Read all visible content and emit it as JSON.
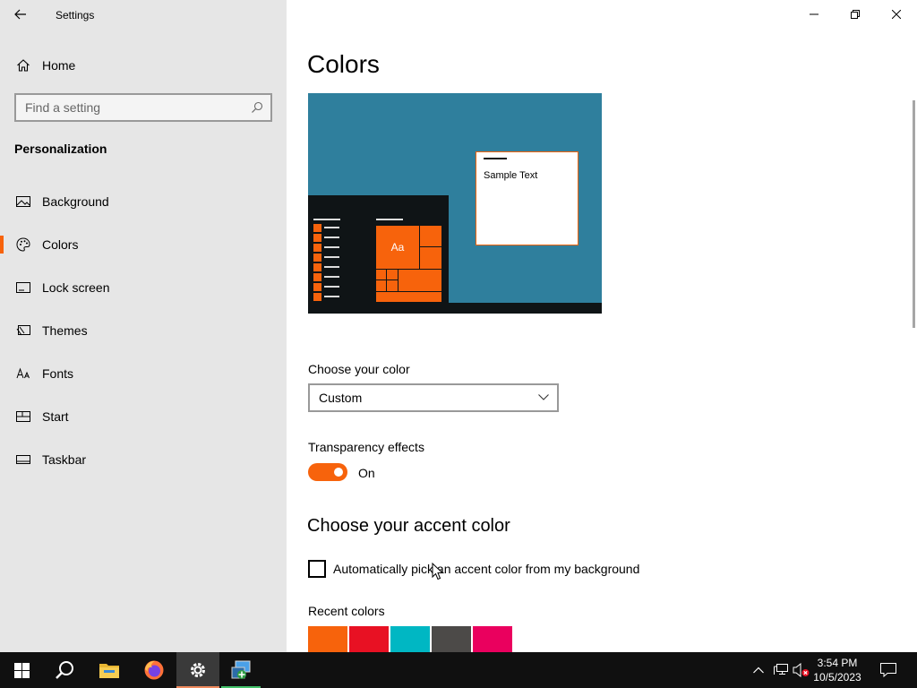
{
  "window": {
    "title": "Settings",
    "controls": {
      "minimize": "minimize-icon",
      "restore": "restore-icon",
      "close": "close-icon"
    }
  },
  "sidebar": {
    "home_label": "Home",
    "search_placeholder": "Find a setting",
    "section_title": "Personalization",
    "items": [
      {
        "label": "Background",
        "icon": "picture-icon"
      },
      {
        "label": "Colors",
        "icon": "palette-icon",
        "active": true
      },
      {
        "label": "Lock screen",
        "icon": "lock-screen-icon"
      },
      {
        "label": "Themes",
        "icon": "themes-icon"
      },
      {
        "label": "Fonts",
        "icon": "fonts-icon"
      },
      {
        "label": "Start",
        "icon": "start-icon"
      },
      {
        "label": "Taskbar",
        "icon": "taskbar-icon"
      }
    ]
  },
  "main": {
    "title": "Colors",
    "preview": {
      "sample_text": "Sample Text",
      "tile_text": "Aa"
    },
    "choose_color_label": "Choose your color",
    "choose_color_value": "Custom",
    "transparency_label": "Transparency effects",
    "transparency_state": "On",
    "accent_heading": "Choose your accent color",
    "auto_pick_label": "Automatically pick an accent color from my background",
    "recent_colors_label": "Recent colors",
    "recent_colors": [
      "#f7630c",
      "#e81123",
      "#00b7c3",
      "#4c4a48",
      "#ea005e"
    ]
  },
  "accent": "#f7630c",
  "taskbar": {
    "time": "3:54 PM",
    "date": "10/5/2023",
    "apps": [
      "start-icon",
      "search-icon",
      "file-explorer-icon",
      "firefox-icon",
      "settings-icon",
      "control-panel-icon"
    ]
  }
}
